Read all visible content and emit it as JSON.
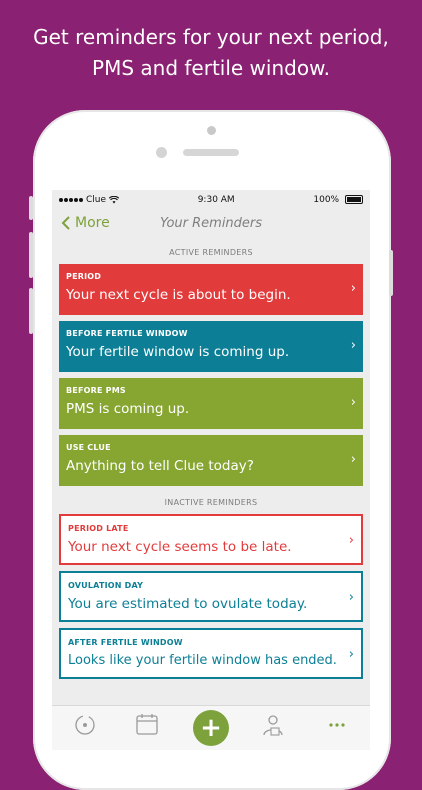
{
  "headline": {
    "line1": "Get reminders for your next period,",
    "line2": "PMS and fertile window."
  },
  "status_bar": {
    "carrier": "Clue",
    "time": "9:30 AM",
    "battery": "100%"
  },
  "nav": {
    "back_label": "More",
    "title": "Your Reminders"
  },
  "sections": {
    "active": "ACTIVE REMINDERS",
    "inactive": "INACTIVE REMINDERS"
  },
  "active_reminders": [
    {
      "title": "PERIOD",
      "message": "Your next cycle is about to begin.",
      "color": "#e23b3c"
    },
    {
      "title": "BEFORE FERTILE WINDOW",
      "message": "Your fertile window is coming up.",
      "color": "#0c7f96"
    },
    {
      "title": "BEFORE PMS",
      "message": "PMS is coming up.",
      "color": "#87a531"
    },
    {
      "title": "USE CLUE",
      "message": "Anything to tell Clue today?",
      "color": "#87a531"
    }
  ],
  "inactive_reminders": [
    {
      "title": "PERIOD LATE",
      "message": "Your next cycle seems to be late.",
      "color": "#e23b3c"
    },
    {
      "title": "OVULATION DAY",
      "message": "You are estimated to ovulate today.",
      "color": "#0c7f96"
    },
    {
      "title": "AFTER FERTILE WINDOW",
      "message": "Looks like your fertile window has ended.",
      "color": "#0c7f96"
    }
  ],
  "tab_bar": {
    "items": [
      "cycle-icon",
      "calendar-icon",
      "plus-icon",
      "profile-icon",
      "more-icon"
    ],
    "plus_label": "+",
    "accent": "#7da23b"
  },
  "colors": {
    "background": "#8a2172",
    "accent": "#7da23b"
  }
}
